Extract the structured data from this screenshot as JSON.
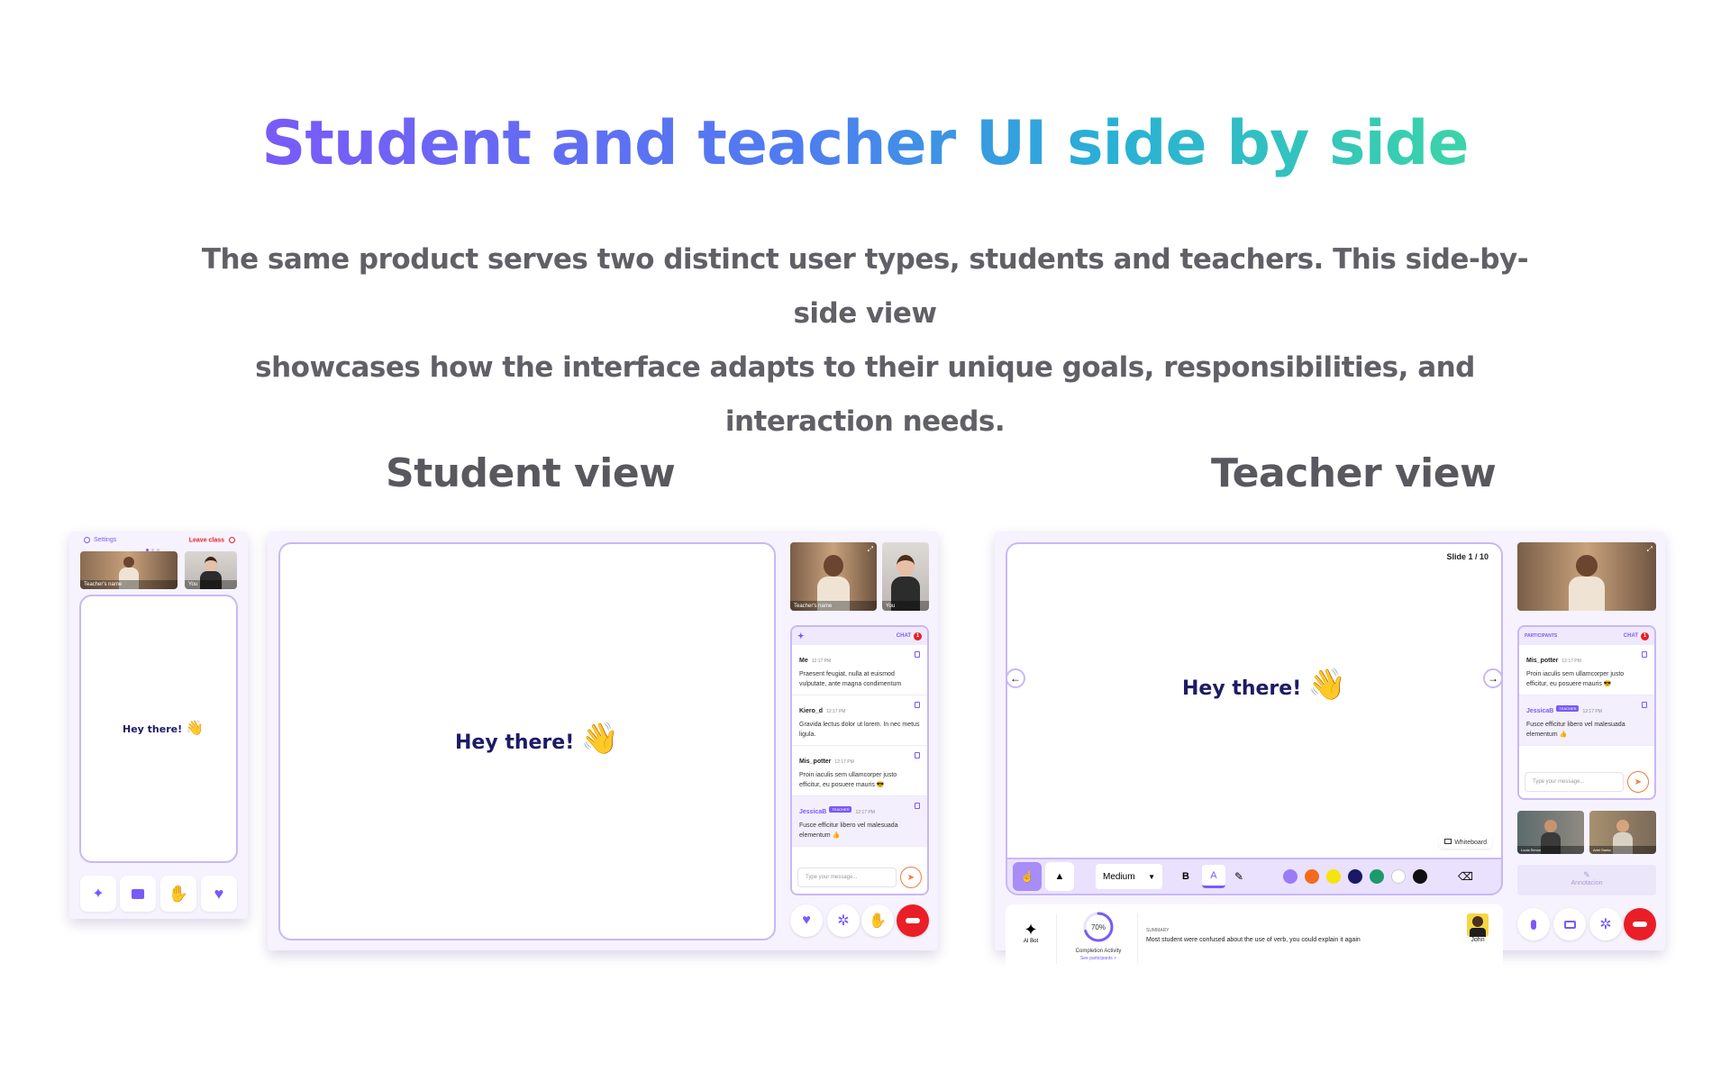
{
  "hero": {
    "title": "Student and teacher UI side by side",
    "subtitle_line1": "The same product serves two distinct user types, students and teachers. This side-by-side view",
    "subtitle_line2": "showcases how the interface adapts to their unique goals, responsibilities, and interaction needs."
  },
  "student_section": {
    "title": "Student view"
  },
  "teacher_section": {
    "title": "Teacher view"
  },
  "mobile": {
    "settings": "Settings",
    "leave": "Leave class",
    "teacher_label": "Teacher's name",
    "you_label": "You",
    "greeting": "Hey there!",
    "emoji": "👋"
  },
  "student_desktop": {
    "greeting": "Hey there!",
    "emoji": "👋",
    "teacher_label": "Teacher's name",
    "you_label": "You",
    "chat_tab": "CHAT",
    "chat_badge": "1",
    "messages": [
      {
        "who": "Me",
        "time": "12:17 PM",
        "text": "Praesent feugiat, nulla at euismod vulputate, ante magna condimentum"
      },
      {
        "who": "Kiero_d",
        "time": "12:17 PM",
        "text": "Gravida lectus dolor ut lorem. In nec metus ligula."
      },
      {
        "who": "Mis_potter",
        "time": "12:17 PM",
        "text": "Proin iaculis sem ullamcorper justo efficitur, eu posuere mauris 😎"
      },
      {
        "who": "JessicaB",
        "tag": "TEACHER",
        "time": "12:17 PM",
        "text": "Fusce efficitur libero vel malesuada elementum 👍"
      }
    ],
    "placeholder": "Type your message..."
  },
  "teacher_desktop": {
    "slide": "Slide 1 / 10",
    "greeting": "Hey there!",
    "emoji": "👋",
    "whiteboard": "Whiteboard",
    "size_option": "Medium",
    "bold": "B",
    "font_a": "A",
    "colors": [
      "#9b7cf7",
      "#f26b1d",
      "#f5e50a",
      "#1a1966",
      "#1d9a6c",
      "#ffffff",
      "#111111"
    ],
    "participants_tab": "PARTICIPANTS",
    "chat_tab": "CHAT",
    "chat_badge": "1",
    "messages": [
      {
        "who": "Mis_potter",
        "time": "12:17 PM",
        "text": "Proin iaculis sem ullamcorper justo efficitur, eu posuere mauris 😎"
      },
      {
        "who": "JessicaB",
        "tag": "TEACHER",
        "time": "12:17 PM",
        "text": "Fusce efficitur libero vel malesuada elementum 👍"
      }
    ],
    "placeholder": "Type your message...",
    "annotation": "Annotacion",
    "ai_bot": "AI Bot",
    "completion_pct": "70%",
    "completion_value": 0.7,
    "completion_label": "Completion Activity",
    "see_participants": "See participants >",
    "summary_label": "SUMMARY",
    "summary_text": "Most student were confused about the use of verb, you could explain it again",
    "student_name": "John",
    "thumb1_label": "Louis Simon",
    "thumb2_label": "Ariel Santa"
  }
}
